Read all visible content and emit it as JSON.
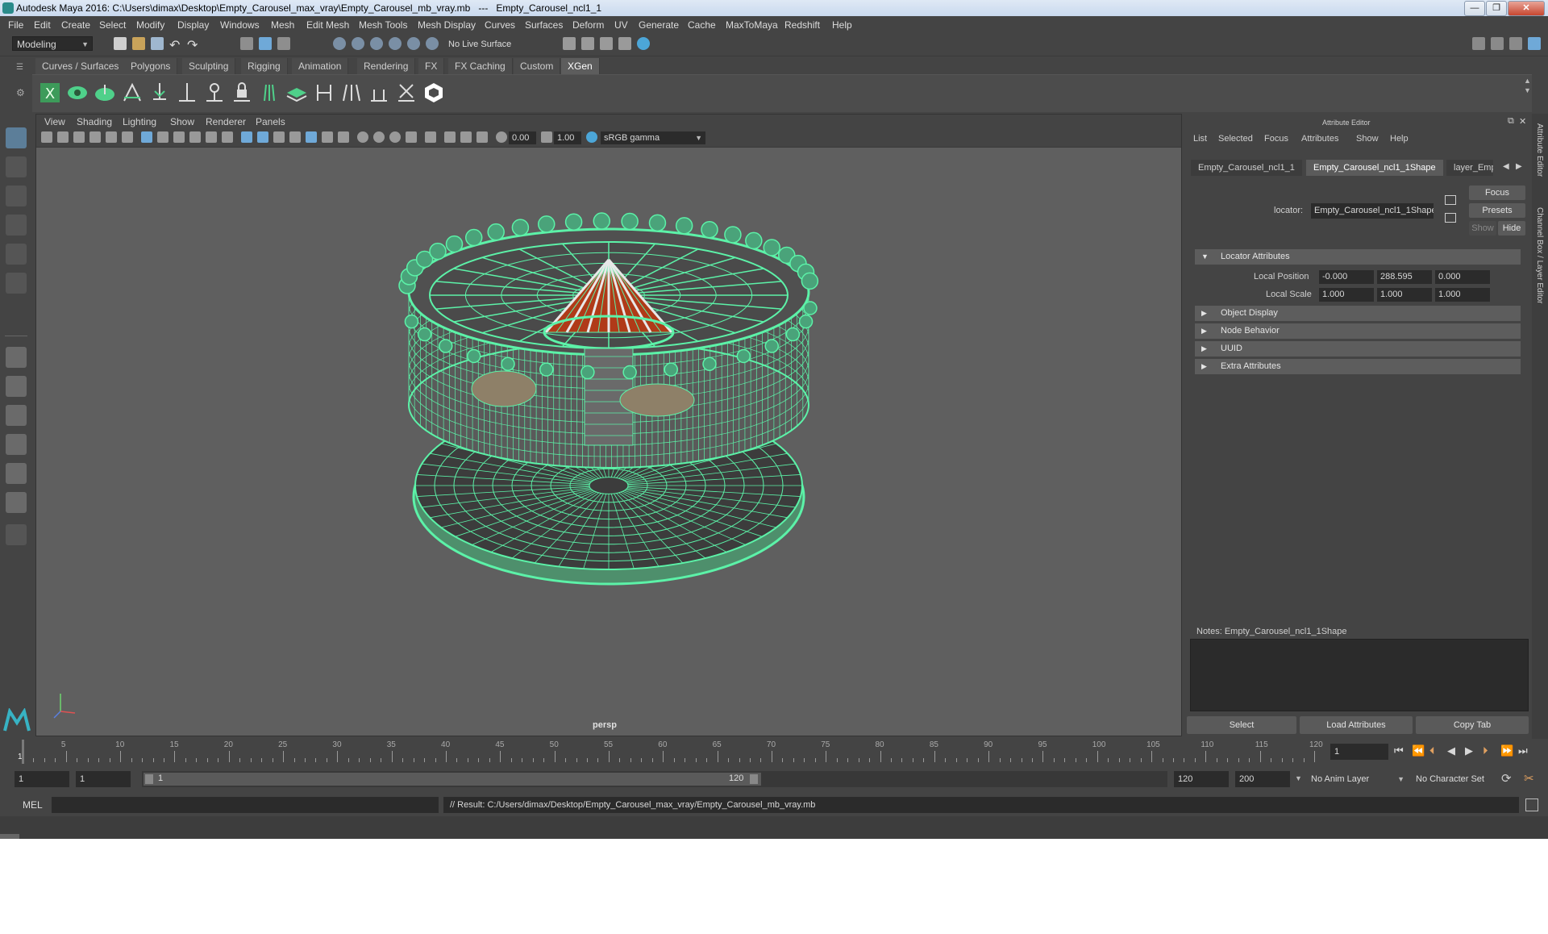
{
  "window": {
    "title": "Autodesk Maya 2016: C:\\Users\\dimax\\Desktop\\Empty_Carousel_max_vray\\Empty_Carousel_mb_vray.mb   ---   Empty_Carousel_ncl1_1",
    "minimize": "—",
    "restore": "❐",
    "close": "✕"
  },
  "menubar": [
    "File",
    "Edit",
    "Create",
    "Select",
    "Modify",
    "Display",
    "Windows",
    "Mesh",
    "Edit Mesh",
    "Mesh Tools",
    "Mesh Display",
    "Curves",
    "Surfaces",
    "Deform",
    "UV",
    "Generate",
    "Cache",
    "MaxToMaya",
    "Redshift",
    "Help"
  ],
  "statusline": {
    "mode": "Modeling",
    "live_surface": "No Live Surface"
  },
  "shelf": {
    "tabs": [
      "Curves / Surfaces",
      "Polygons",
      "Sculpting",
      "Rigging",
      "Animation",
      "Rendering",
      "FX",
      "FX Caching",
      "Custom",
      "XGen"
    ],
    "active_tab": "XGen"
  },
  "viewport": {
    "menus": [
      "View",
      "Shading",
      "Lighting",
      "Show",
      "Renderer",
      "Panels"
    ],
    "exposure": "0.00",
    "gamma": "1.00",
    "color_space": "sRGB gamma",
    "camera": "persp",
    "wire_color": "#5cf2a8"
  },
  "attribute_editor": {
    "title": "Attribute Editor",
    "menus": [
      "List",
      "Selected",
      "Focus",
      "Attributes",
      "Show",
      "Help"
    ],
    "tabs": [
      "Empty_Carousel_ncl1_1",
      "Empty_Carousel_ncl1_1Shape",
      "layer_Empty"
    ],
    "active_tab": "Empty_Carousel_ncl1_1Shape",
    "node_type_label": "locator:",
    "node_name": "Empty_Carousel_ncl1_1Shape",
    "focus_btn": "Focus",
    "presets_btn": "Presets",
    "show_btn": "Show",
    "hide_btn": "Hide",
    "sections": [
      {
        "label": "Locator Attributes",
        "expanded": true
      },
      {
        "label": "Object Display",
        "expanded": false
      },
      {
        "label": "Node Behavior",
        "expanded": false
      },
      {
        "label": "UUID",
        "expanded": false
      },
      {
        "label": "Extra Attributes",
        "expanded": false
      }
    ],
    "local_position": {
      "label": "Local Position",
      "values": [
        "-0.000",
        "288.595",
        "0.000"
      ]
    },
    "local_scale": {
      "label": "Local Scale",
      "values": [
        "1.000",
        "1.000",
        "1.000"
      ]
    },
    "notes_label": "Notes:  Empty_Carousel_ncl1_1Shape",
    "buttons": [
      "Select",
      "Load Attributes",
      "Copy Tab"
    ]
  },
  "side_tabs": [
    "Attribute Editor",
    "Channel Box / Layer Editor"
  ],
  "timeline": {
    "labels": [
      "1",
      "5",
      "10",
      "15",
      "20",
      "25",
      "30",
      "35",
      "40",
      "45",
      "50",
      "55",
      "60",
      "65",
      "70",
      "75",
      "80",
      "85",
      "90",
      "95",
      "100",
      "105",
      "110",
      "115",
      "120"
    ],
    "current_frame": "1"
  },
  "range": {
    "start": "1",
    "anim_start": "1",
    "slider_start": "1",
    "slider_end": "120",
    "end": "120",
    "anim_end": "200",
    "anim_layer": "No Anim Layer",
    "character_set": "No Character Set"
  },
  "cmdline": {
    "lang": "MEL",
    "result": "// Result: C:/Users/dimax/Desktop/Empty_Carousel_max_vray/Empty_Carousel_mb_vray.mb"
  }
}
